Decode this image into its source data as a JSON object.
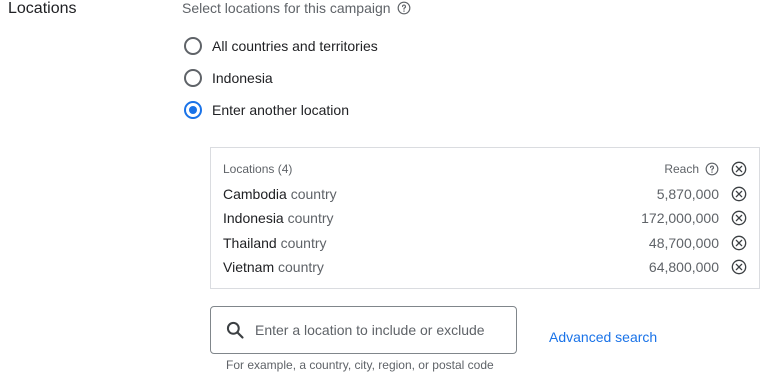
{
  "section": {
    "title": "Locations",
    "subtitle": "Select locations for this campaign"
  },
  "options": [
    {
      "label": "All countries and territories",
      "checked": false
    },
    {
      "label": "Indonesia",
      "checked": false
    },
    {
      "label": "Enter another location",
      "checked": true
    }
  ],
  "panel": {
    "header": "Locations (4)",
    "reach_label": "Reach",
    "rows": [
      {
        "name": "Cambodia",
        "type": "country",
        "reach": "5,870,000"
      },
      {
        "name": "Indonesia",
        "type": "country",
        "reach": "172,000,000"
      },
      {
        "name": "Thailand",
        "type": "country",
        "reach": "48,700,000"
      },
      {
        "name": "Vietnam",
        "type": "country",
        "reach": "64,800,000"
      }
    ]
  },
  "search": {
    "placeholder": "Enter a location to include or exclude",
    "value": "",
    "hint": "For example, a country, city, region, or postal code"
  },
  "advanced_search_label": "Advanced search",
  "icons": {
    "help": "help-icon",
    "remove": "close-circle-icon",
    "search": "search-icon"
  },
  "colors": {
    "accent": "#1a73e8",
    "text": "#202124",
    "secondary": "#5f6368",
    "border": "#dadce0"
  }
}
